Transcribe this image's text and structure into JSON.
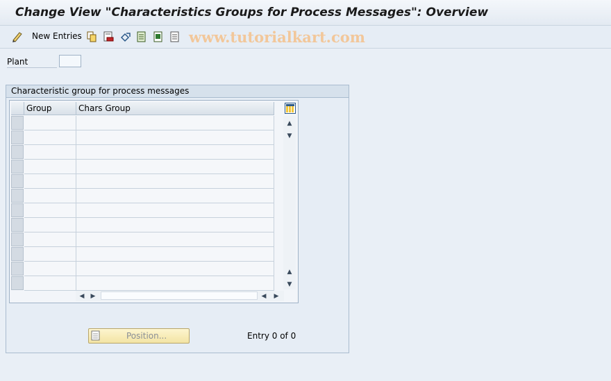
{
  "window": {
    "title": "Change View \"Characteristics Groups for Process Messages\": Overview"
  },
  "toolbar": {
    "new_entries_label": "New Entries",
    "icons": [
      "edit-glasses-icon",
      "copy-icon",
      "delete-icon",
      "undo-icon",
      "select-all-icon",
      "select-block-icon",
      "deselect-all-icon"
    ],
    "watermark": "www.tutorialkart.com"
  },
  "filter": {
    "plant_label": "Plant",
    "plant_value": ""
  },
  "group": {
    "title": "Characteristic group for process messages",
    "columns": [
      "Group",
      "Chars Group"
    ],
    "rows": [
      [
        "",
        ""
      ],
      [
        "",
        ""
      ],
      [
        "",
        ""
      ],
      [
        "",
        ""
      ],
      [
        "",
        ""
      ],
      [
        "",
        ""
      ],
      [
        "",
        ""
      ],
      [
        "",
        ""
      ],
      [
        "",
        ""
      ],
      [
        "",
        ""
      ],
      [
        "",
        ""
      ],
      [
        "",
        ""
      ]
    ]
  },
  "footer": {
    "position_label": "Position...",
    "entry_label": "Entry 0 of 0"
  },
  "colors": {
    "accent": "#2c5a8a",
    "background": "#e9eff6",
    "button": "#f3e4a4"
  }
}
